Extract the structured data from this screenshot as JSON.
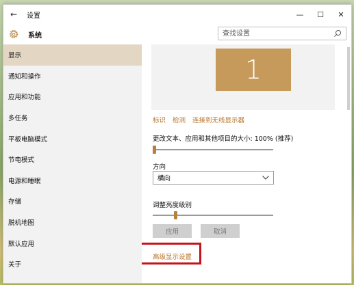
{
  "window": {
    "title": "设置",
    "controls": {
      "minimize": "—",
      "maximize": "☐",
      "close": "✕"
    }
  },
  "header": {
    "section": "系统",
    "search_placeholder": "查找设置"
  },
  "sidebar": {
    "items": [
      {
        "label": "显示",
        "active": true
      },
      {
        "label": "通知和操作"
      },
      {
        "label": "应用和功能"
      },
      {
        "label": "多任务"
      },
      {
        "label": "平板电脑模式"
      },
      {
        "label": "节电模式"
      },
      {
        "label": "电源和睡眠"
      },
      {
        "label": "存储"
      },
      {
        "label": "脱机地图"
      },
      {
        "label": "默认应用"
      },
      {
        "label": "关于"
      }
    ]
  },
  "display": {
    "monitor_number": "1",
    "links": {
      "identify": "标识",
      "detect": "检测",
      "wireless": "连接到无线显示器"
    },
    "scale_label": "更改文本、应用和其他项目的大小: 100% (推荐)",
    "scale_level": 0,
    "orientation_label": "方向",
    "orientation_value": "横向",
    "brightness_label": "调整亮度级别",
    "brightness_level": 0.18,
    "apply_button": "应用",
    "cancel_button": "取消",
    "advanced_link": "高级显示设置"
  },
  "colors": {
    "accent": "#c69a5a",
    "link": "#b8742a",
    "highlight": "#c6131b",
    "sidebar_active": "#e3d6c3"
  }
}
